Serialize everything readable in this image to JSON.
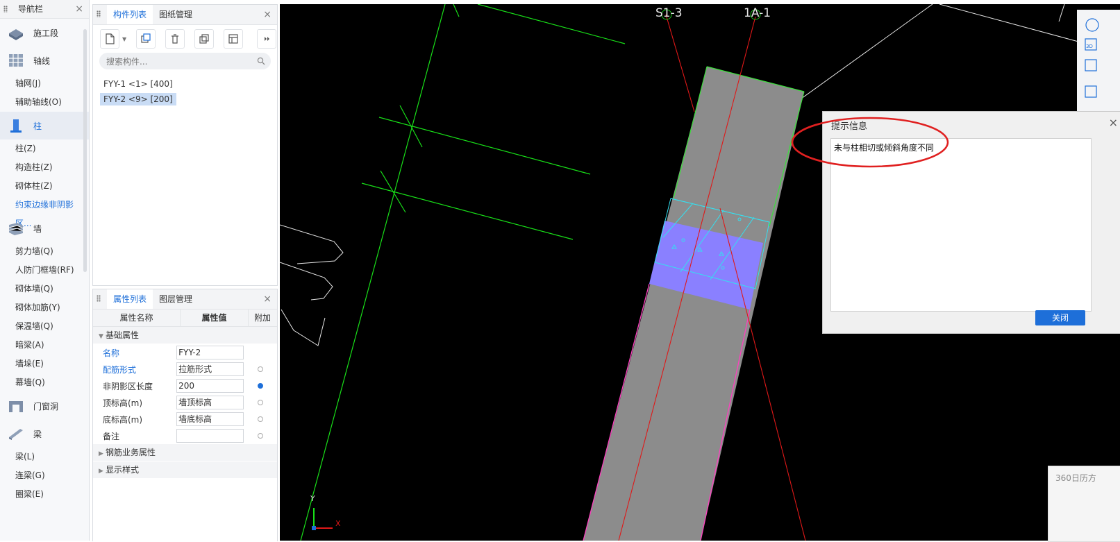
{
  "nav": {
    "title": "导航栏",
    "close": "×",
    "items": [
      {
        "type": "cat",
        "label": "施工段",
        "icon": "stage-icon"
      },
      {
        "type": "cat",
        "label": "轴线",
        "icon": "grid-icon"
      },
      {
        "type": "sub",
        "label": "轴网(J)"
      },
      {
        "type": "sub",
        "label": "辅助轴线(O)"
      },
      {
        "type": "cat",
        "label": "柱",
        "icon": "column-icon",
        "active": true
      },
      {
        "type": "sub",
        "label": "柱(Z)"
      },
      {
        "type": "sub",
        "label": "构造柱(Z)"
      },
      {
        "type": "sub",
        "label": "砌体柱(Z)"
      },
      {
        "type": "sub",
        "label": "约束边缘非阴影区...",
        "highlight": true
      },
      {
        "type": "cat",
        "label": "墙",
        "icon": "wall-icon"
      },
      {
        "type": "sub",
        "label": "剪力墙(Q)"
      },
      {
        "type": "sub",
        "label": "人防门框墙(RF)"
      },
      {
        "type": "sub",
        "label": "砌体墙(Q)"
      },
      {
        "type": "sub",
        "label": "砌体加筋(Y)"
      },
      {
        "type": "sub",
        "label": "保温墙(Q)"
      },
      {
        "type": "sub",
        "label": "暗梁(A)"
      },
      {
        "type": "sub",
        "label": "墙垛(E)"
      },
      {
        "type": "sub",
        "label": "幕墙(Q)"
      },
      {
        "type": "cat",
        "label": "门窗洞",
        "icon": "door-window-icon"
      },
      {
        "type": "cat",
        "label": "梁",
        "icon": "beam-icon"
      },
      {
        "type": "sub",
        "label": "梁(L)"
      },
      {
        "type": "sub",
        "label": "连梁(G)"
      },
      {
        "type": "sub",
        "label": "圈梁(E)"
      }
    ]
  },
  "complist": {
    "tabs": [
      "构件列表",
      "图纸管理"
    ],
    "active_tab": 0,
    "close": "×",
    "search_placeholder": "搜索构件...",
    "items": [
      {
        "label": "FYY-1 <1> [400]",
        "selected": false
      },
      {
        "label": "FYY-2 <9> [200]",
        "selected": true
      }
    ]
  },
  "proplist": {
    "tabs": [
      "属性列表",
      "图层管理"
    ],
    "close": "×",
    "headers": [
      "属性名称",
      "属性值",
      "附加"
    ],
    "group1": "基础属性",
    "rows": [
      {
        "name": "名称",
        "value": "FYY-2",
        "blue": true,
        "dot": "none"
      },
      {
        "name": "配筋形式",
        "value": "拉筋形式",
        "blue": true,
        "dot": "off"
      },
      {
        "name": "非阴影区长度",
        "value": "200",
        "blue": false,
        "dot": "on"
      },
      {
        "name": "顶标高(m)",
        "value": "墙顶标高",
        "blue": false,
        "dot": "off"
      },
      {
        "name": "底标高(m)",
        "value": "墙底标高",
        "blue": false,
        "dot": "off"
      },
      {
        "name": "备注",
        "value": "",
        "blue": false,
        "dot": "off"
      }
    ],
    "group2": "钢筋业务属性",
    "group3": "显示样式"
  },
  "canvas": {
    "axis_labels": [
      "S1-3",
      "1A-1"
    ],
    "coord_y": "Y",
    "coord_x": "X",
    "colors": {
      "background": "#000000",
      "grid_green": "#18e018",
      "axis_red": "#e01818",
      "wall_gray": "#8c8c8c",
      "cyan": "#34e0f0",
      "violet": "#8a80ff",
      "magenta": "#ff40c0"
    }
  },
  "dialog": {
    "title": "提示信息",
    "message": "未与柱相切或倾斜角度不同",
    "close_button": "关闭",
    "close_icon": "×"
  },
  "toast": {
    "text": "360日历方"
  }
}
